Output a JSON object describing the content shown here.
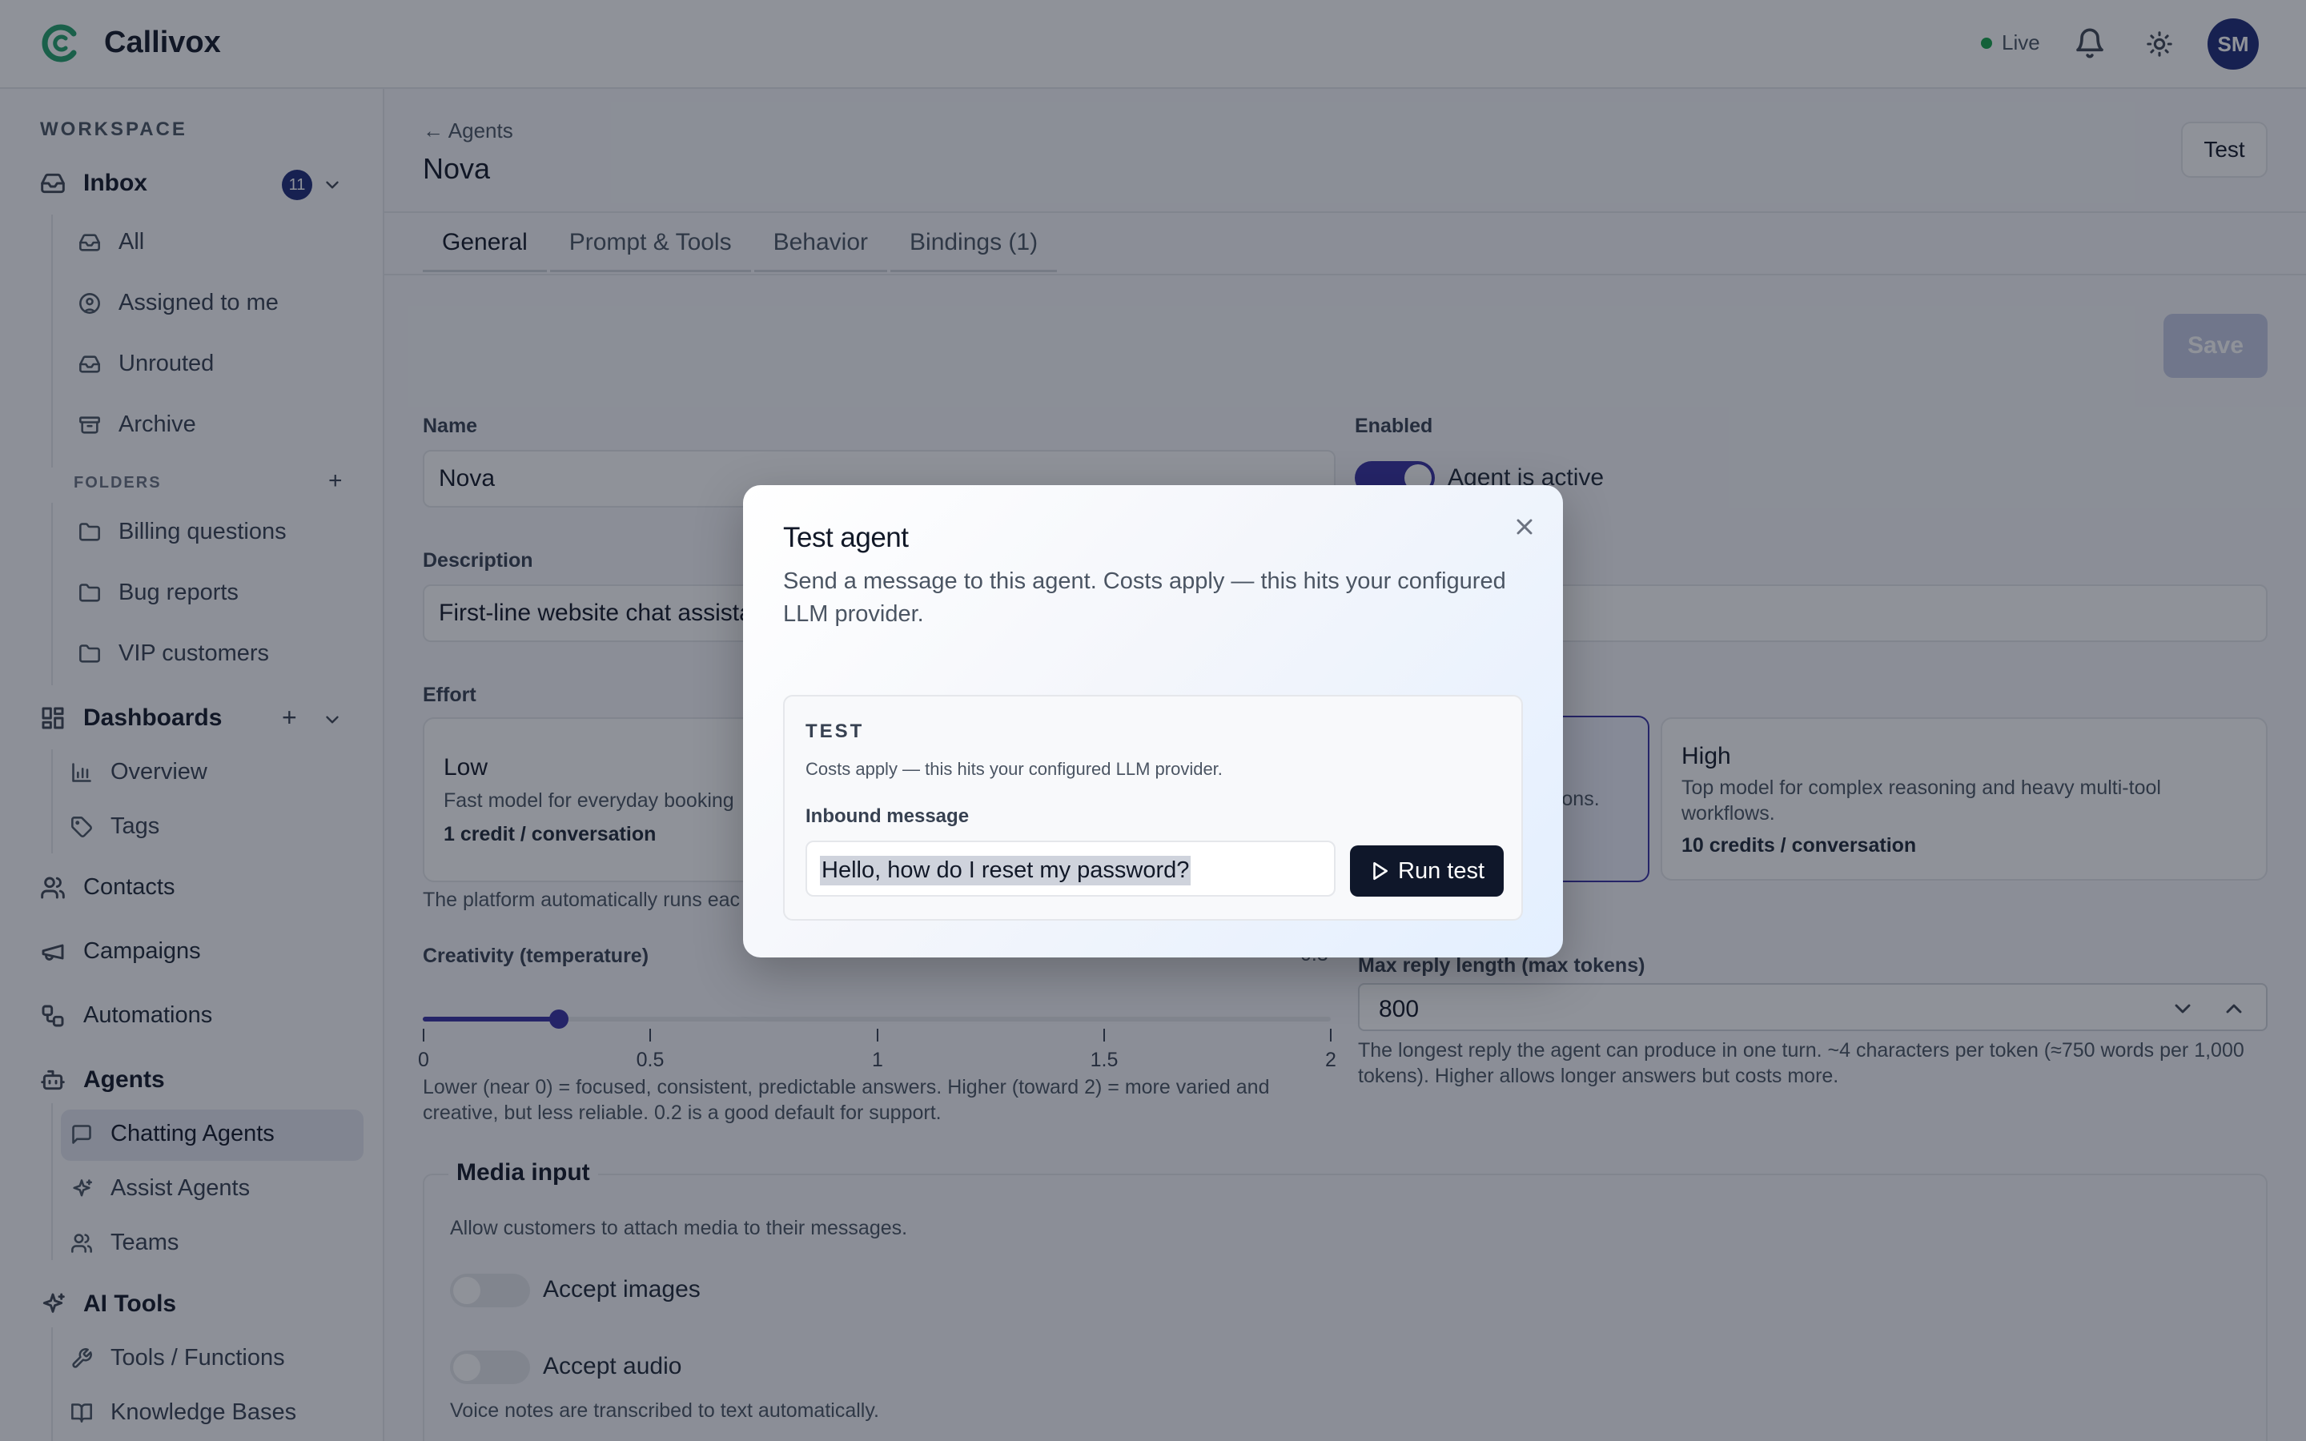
{
  "app": {
    "name": "Callivox",
    "status": "Live",
    "avatar_initials": "SM",
    "brand_color": "#22a06b",
    "accent": "#3730a3"
  },
  "sidebar": {
    "workspace_label": "WORKSPACE",
    "inbox": {
      "label": "Inbox",
      "badge": "11"
    },
    "inbox_items": [
      "All",
      "Assigned to me",
      "Unrouted",
      "Archive"
    ],
    "folders_label": "FOLDERS",
    "folders": [
      "Billing questions",
      "Bug reports",
      "VIP customers"
    ],
    "dashboards": {
      "label": "Dashboards",
      "items": [
        "Overview",
        "Tags"
      ]
    },
    "contacts": "Contacts",
    "campaigns": "Campaigns",
    "automations": "Automations",
    "agents": {
      "label": "Agents",
      "items": [
        "Chatting Agents",
        "Assist Agents",
        "Teams"
      ]
    },
    "ai_tools": {
      "label": "AI Tools",
      "items": [
        "Tools / Functions",
        "Knowledge Bases"
      ]
    }
  },
  "page": {
    "back": "← Agents",
    "title": "Nova",
    "test_button": "Test",
    "tabs": [
      "General",
      "Prompt & Tools",
      "Behavior",
      "Bindings (1)"
    ],
    "save": "Save",
    "name_label": "Name",
    "name_value": "Nova",
    "enabled_label": "Enabled",
    "enabled_text": "Agent is active",
    "description_label": "Description",
    "description_value": "First-line website chat assista",
    "effort_label": "Effort",
    "effort": {
      "low": {
        "title": "Low",
        "desc": "Fast model for everyday booking",
        "cost": "1 credit / conversation"
      },
      "medium_desc_tail": "ations.",
      "high": {
        "title": "High",
        "desc": "Top model for complex reasoning and heavy multi-tool workflows.",
        "cost": "10 credits / conversation"
      }
    },
    "effort_help": "The platform automatically runs eac",
    "creativity_label": "Creativity (temperature)",
    "creativity_value": "0.3",
    "creativity": {
      "value": 0.3,
      "min": 0,
      "max": 2
    },
    "ticks": [
      "0",
      "0.5",
      "1",
      "1.5",
      "2"
    ],
    "creativity_help": "Lower (near 0) = focused, consistent, predictable answers. Higher (toward 2) = more varied and creative, but less reliable. 0.2 is a good default for support.",
    "max_tokens_label": "Max reply length (max tokens)",
    "max_tokens_value": "800",
    "max_tokens_help": "The longest reply the agent can produce in one turn. ~4 characters per token (≈750 words per 1,000 tokens). Higher allows longer answers but costs more.",
    "media_label": "Media input",
    "media_desc": "Allow customers to attach media to their messages.",
    "accept_images": "Accept images",
    "accept_audio": "Accept audio",
    "audio_help": "Voice notes are transcribed to text automatically."
  },
  "modal": {
    "title": "Test agent",
    "subtitle": "Send a message to this agent. Costs apply — this hits your configured LLM provider.",
    "section_title": "TEST",
    "section_note": "Costs apply — this hits your configured LLM provider.",
    "input_label": "Inbound message",
    "input_value": "Hello, how do I reset my password?",
    "run_button": "Run test"
  }
}
